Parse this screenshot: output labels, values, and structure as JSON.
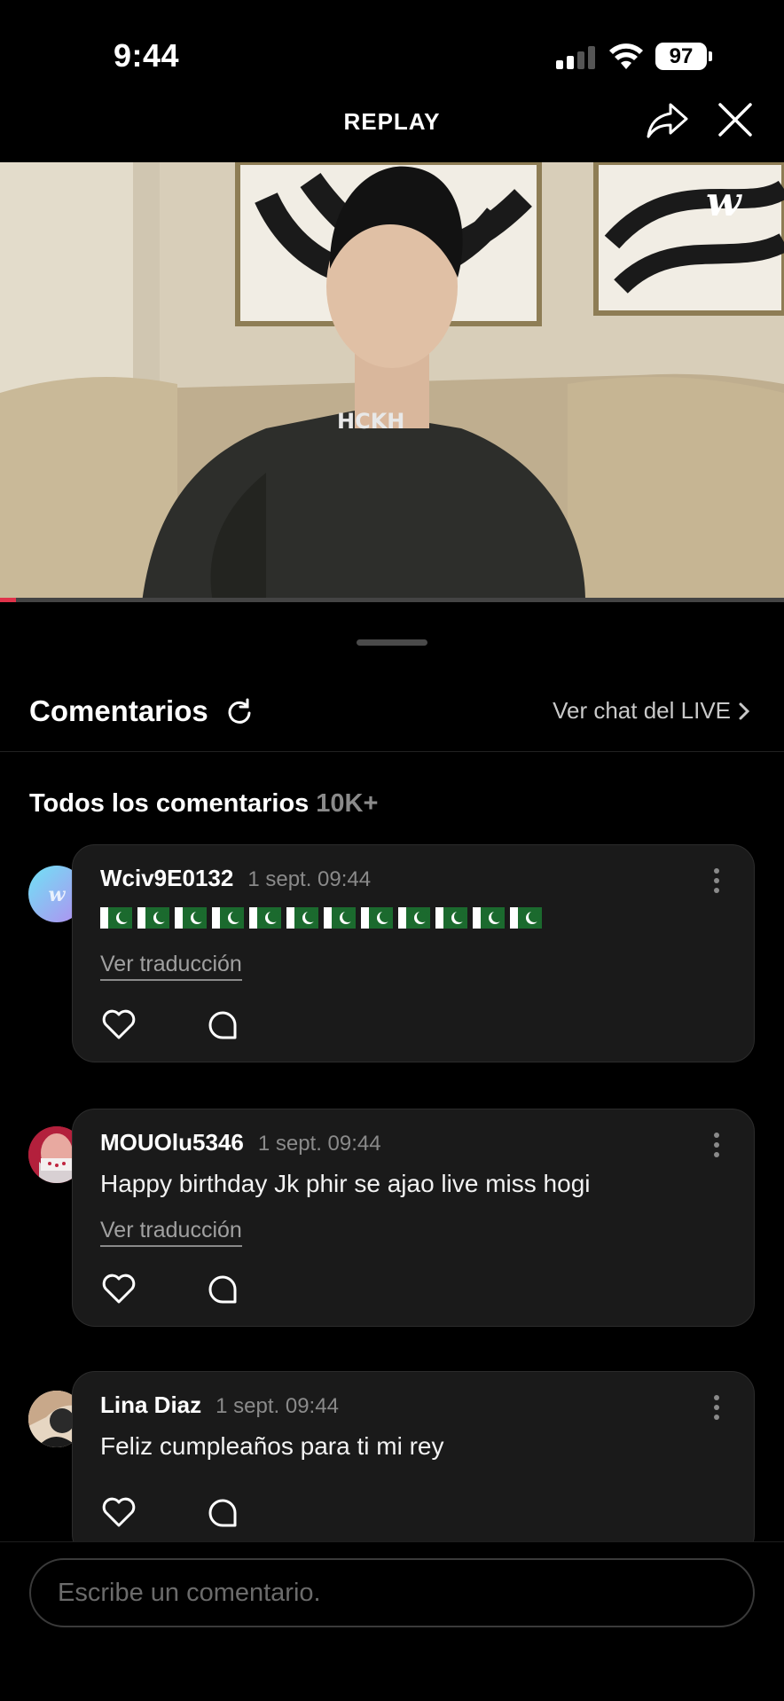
{
  "status_bar": {
    "time": "9:44",
    "battery": "97"
  },
  "top_bar": {
    "title": "REPLAY"
  },
  "video": {
    "progress": 0.02
  },
  "comments_section": {
    "title": "Comentarios",
    "live_chat_link": "Ver chat del LIVE",
    "all_label": "Todos los comentarios",
    "count": "10K+"
  },
  "comments": [
    {
      "username": "Wciv9E0132",
      "date": "1 sept. 09:44",
      "text": "🇵🇰🇵🇰🇵🇰🇵🇰🇵🇰🇵🇰🇵🇰🇵🇰🇵🇰🇵🇰🇵🇰🇵🇰",
      "translate": "Ver traducción"
    },
    {
      "username": "MOUOlu5346",
      "date": "1 sept. 09:44",
      "text": "Happy birthday Jk phir se ajao live miss hogi",
      "translate": "Ver traducción"
    },
    {
      "username": "Lina Diaz",
      "date": "1 sept. 09:44",
      "text": "Feliz cumpleaños para ti mi rey"
    }
  ],
  "input": {
    "placeholder": "Escribe un comentario."
  },
  "colors": {
    "background": "#000000",
    "card": "#1a1a1a",
    "accent": "#e0334a"
  }
}
